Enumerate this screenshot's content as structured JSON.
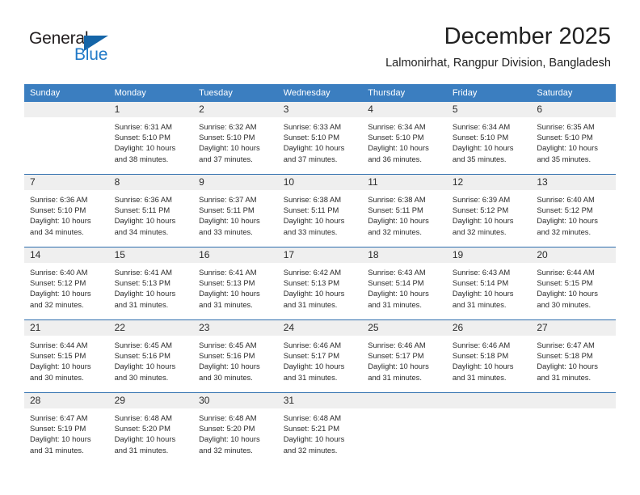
{
  "logo": {
    "word_one": "General",
    "word_two": "Blue",
    "triangle_icon": "triangle-icon"
  },
  "header": {
    "month_title": "December 2025",
    "location": "Lalmonirhat, Rangpur Division, Bangladesh"
  },
  "colors": {
    "header_blue": "#3b7ec0",
    "rule_blue": "#2f6fae",
    "daynum_band": "#efefef",
    "logo_blue": "#2079c7",
    "text": "#2b2b2b"
  },
  "calendar": {
    "weekday_headers": [
      "Sunday",
      "Monday",
      "Tuesday",
      "Wednesday",
      "Thursday",
      "Friday",
      "Saturday"
    ],
    "weeks": [
      [
        {
          "day": "",
          "sunrise": "",
          "sunset": "",
          "daylight_line1": "",
          "daylight_line2": ""
        },
        {
          "day": "1",
          "sunrise": "Sunrise: 6:31 AM",
          "sunset": "Sunset: 5:10 PM",
          "daylight_line1": "Daylight: 10 hours",
          "daylight_line2": "and 38 minutes."
        },
        {
          "day": "2",
          "sunrise": "Sunrise: 6:32 AM",
          "sunset": "Sunset: 5:10 PM",
          "daylight_line1": "Daylight: 10 hours",
          "daylight_line2": "and 37 minutes."
        },
        {
          "day": "3",
          "sunrise": "Sunrise: 6:33 AM",
          "sunset": "Sunset: 5:10 PM",
          "daylight_line1": "Daylight: 10 hours",
          "daylight_line2": "and 37 minutes."
        },
        {
          "day": "4",
          "sunrise": "Sunrise: 6:34 AM",
          "sunset": "Sunset: 5:10 PM",
          "daylight_line1": "Daylight: 10 hours",
          "daylight_line2": "and 36 minutes."
        },
        {
          "day": "5",
          "sunrise": "Sunrise: 6:34 AM",
          "sunset": "Sunset: 5:10 PM",
          "daylight_line1": "Daylight: 10 hours",
          "daylight_line2": "and 35 minutes."
        },
        {
          "day": "6",
          "sunrise": "Sunrise: 6:35 AM",
          "sunset": "Sunset: 5:10 PM",
          "daylight_line1": "Daylight: 10 hours",
          "daylight_line2": "and 35 minutes."
        }
      ],
      [
        {
          "day": "7",
          "sunrise": "Sunrise: 6:36 AM",
          "sunset": "Sunset: 5:10 PM",
          "daylight_line1": "Daylight: 10 hours",
          "daylight_line2": "and 34 minutes."
        },
        {
          "day": "8",
          "sunrise": "Sunrise: 6:36 AM",
          "sunset": "Sunset: 5:11 PM",
          "daylight_line1": "Daylight: 10 hours",
          "daylight_line2": "and 34 minutes."
        },
        {
          "day": "9",
          "sunrise": "Sunrise: 6:37 AM",
          "sunset": "Sunset: 5:11 PM",
          "daylight_line1": "Daylight: 10 hours",
          "daylight_line2": "and 33 minutes."
        },
        {
          "day": "10",
          "sunrise": "Sunrise: 6:38 AM",
          "sunset": "Sunset: 5:11 PM",
          "daylight_line1": "Daylight: 10 hours",
          "daylight_line2": "and 33 minutes."
        },
        {
          "day": "11",
          "sunrise": "Sunrise: 6:38 AM",
          "sunset": "Sunset: 5:11 PM",
          "daylight_line1": "Daylight: 10 hours",
          "daylight_line2": "and 32 minutes."
        },
        {
          "day": "12",
          "sunrise": "Sunrise: 6:39 AM",
          "sunset": "Sunset: 5:12 PM",
          "daylight_line1": "Daylight: 10 hours",
          "daylight_line2": "and 32 minutes."
        },
        {
          "day": "13",
          "sunrise": "Sunrise: 6:40 AM",
          "sunset": "Sunset: 5:12 PM",
          "daylight_line1": "Daylight: 10 hours",
          "daylight_line2": "and 32 minutes."
        }
      ],
      [
        {
          "day": "14",
          "sunrise": "Sunrise: 6:40 AM",
          "sunset": "Sunset: 5:12 PM",
          "daylight_line1": "Daylight: 10 hours",
          "daylight_line2": "and 32 minutes."
        },
        {
          "day": "15",
          "sunrise": "Sunrise: 6:41 AM",
          "sunset": "Sunset: 5:13 PM",
          "daylight_line1": "Daylight: 10 hours",
          "daylight_line2": "and 31 minutes."
        },
        {
          "day": "16",
          "sunrise": "Sunrise: 6:41 AM",
          "sunset": "Sunset: 5:13 PM",
          "daylight_line1": "Daylight: 10 hours",
          "daylight_line2": "and 31 minutes."
        },
        {
          "day": "17",
          "sunrise": "Sunrise: 6:42 AM",
          "sunset": "Sunset: 5:13 PM",
          "daylight_line1": "Daylight: 10 hours",
          "daylight_line2": "and 31 minutes."
        },
        {
          "day": "18",
          "sunrise": "Sunrise: 6:43 AM",
          "sunset": "Sunset: 5:14 PM",
          "daylight_line1": "Daylight: 10 hours",
          "daylight_line2": "and 31 minutes."
        },
        {
          "day": "19",
          "sunrise": "Sunrise: 6:43 AM",
          "sunset": "Sunset: 5:14 PM",
          "daylight_line1": "Daylight: 10 hours",
          "daylight_line2": "and 31 minutes."
        },
        {
          "day": "20",
          "sunrise": "Sunrise: 6:44 AM",
          "sunset": "Sunset: 5:15 PM",
          "daylight_line1": "Daylight: 10 hours",
          "daylight_line2": "and 30 minutes."
        }
      ],
      [
        {
          "day": "21",
          "sunrise": "Sunrise: 6:44 AM",
          "sunset": "Sunset: 5:15 PM",
          "daylight_line1": "Daylight: 10 hours",
          "daylight_line2": "and 30 minutes."
        },
        {
          "day": "22",
          "sunrise": "Sunrise: 6:45 AM",
          "sunset": "Sunset: 5:16 PM",
          "daylight_line1": "Daylight: 10 hours",
          "daylight_line2": "and 30 minutes."
        },
        {
          "day": "23",
          "sunrise": "Sunrise: 6:45 AM",
          "sunset": "Sunset: 5:16 PM",
          "daylight_line1": "Daylight: 10 hours",
          "daylight_line2": "and 30 minutes."
        },
        {
          "day": "24",
          "sunrise": "Sunrise: 6:46 AM",
          "sunset": "Sunset: 5:17 PM",
          "daylight_line1": "Daylight: 10 hours",
          "daylight_line2": "and 31 minutes."
        },
        {
          "day": "25",
          "sunrise": "Sunrise: 6:46 AM",
          "sunset": "Sunset: 5:17 PM",
          "daylight_line1": "Daylight: 10 hours",
          "daylight_line2": "and 31 minutes."
        },
        {
          "day": "26",
          "sunrise": "Sunrise: 6:46 AM",
          "sunset": "Sunset: 5:18 PM",
          "daylight_line1": "Daylight: 10 hours",
          "daylight_line2": "and 31 minutes."
        },
        {
          "day": "27",
          "sunrise": "Sunrise: 6:47 AM",
          "sunset": "Sunset: 5:18 PM",
          "daylight_line1": "Daylight: 10 hours",
          "daylight_line2": "and 31 minutes."
        }
      ],
      [
        {
          "day": "28",
          "sunrise": "Sunrise: 6:47 AM",
          "sunset": "Sunset: 5:19 PM",
          "daylight_line1": "Daylight: 10 hours",
          "daylight_line2": "and 31 minutes."
        },
        {
          "day": "29",
          "sunrise": "Sunrise: 6:48 AM",
          "sunset": "Sunset: 5:20 PM",
          "daylight_line1": "Daylight: 10 hours",
          "daylight_line2": "and 31 minutes."
        },
        {
          "day": "30",
          "sunrise": "Sunrise: 6:48 AM",
          "sunset": "Sunset: 5:20 PM",
          "daylight_line1": "Daylight: 10 hours",
          "daylight_line2": "and 32 minutes."
        },
        {
          "day": "31",
          "sunrise": "Sunrise: 6:48 AM",
          "sunset": "Sunset: 5:21 PM",
          "daylight_line1": "Daylight: 10 hours",
          "daylight_line2": "and 32 minutes."
        },
        {
          "day": "",
          "sunrise": "",
          "sunset": "",
          "daylight_line1": "",
          "daylight_line2": ""
        },
        {
          "day": "",
          "sunrise": "",
          "sunset": "",
          "daylight_line1": "",
          "daylight_line2": ""
        },
        {
          "day": "",
          "sunrise": "",
          "sunset": "",
          "daylight_line1": "",
          "daylight_line2": ""
        }
      ]
    ]
  }
}
